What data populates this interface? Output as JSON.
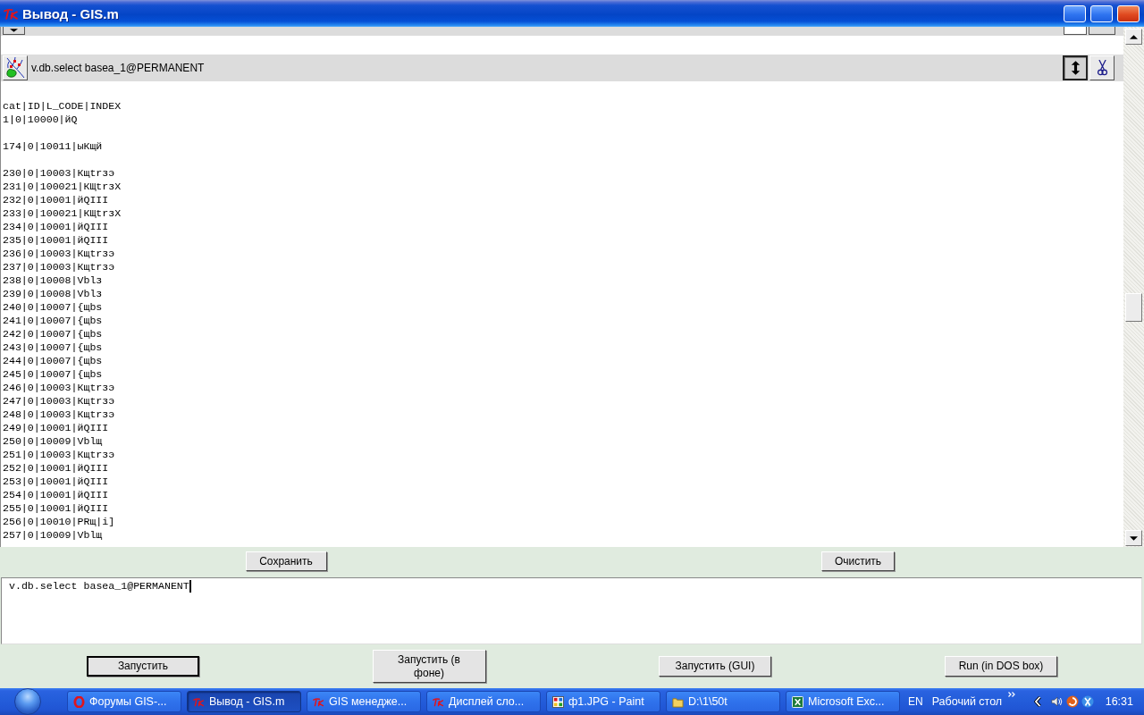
{
  "window": {
    "title": "Вывод - GIS.m"
  },
  "output_panel": {
    "header": {
      "command": "v.db.select basea_1@PERMANENT",
      "buttons": [
        {
          "kind": "resize",
          "pressed": true
        },
        {
          "kind": "cut",
          "pressed": false
        }
      ]
    },
    "output_blocks": [
      [
        "cat|ID|L_CODE|INDEX",
        "1|0|10000|йQ"
      ],
      [
        "174|0|10011|ыКщй"
      ],
      [
        "230|0|10003|Кщtrзэ",
        "231|0|100021|КЩtrзХ",
        "232|0|10001|йQIII",
        "233|0|100021|КЩtrзХ",
        "234|0|10001|йQIII",
        "235|0|10001|йQIII",
        "236|0|10003|Кщtrзэ",
        "237|0|10003|Кщtrзэ",
        "238|0|10008|Vblз",
        "239|0|10008|Vblз",
        "240|0|10007|{щbs",
        "241|0|10007|{щbs",
        "242|0|10007|{щbs",
        "243|0|10007|{щbs",
        "244|0|10007|{щbs",
        "245|0|10007|{щbs",
        "246|0|10003|Кщtrзэ",
        "247|0|10003|Кщtrзэ",
        "248|0|10003|Кщtrзэ",
        "249|0|10001|йQIII",
        "250|0|10009|Vblщ",
        "251|0|10003|Кщtrзэ",
        "252|0|10001|йQIII",
        "253|0|10001|йQIII",
        "254|0|10001|йQIII",
        "255|0|10001|йQIII",
        "256|0|10010|PRщ|i]",
        "257|0|10009|Vblщ"
      ]
    ]
  },
  "output_buttons": [
    {
      "label": "Сохранить"
    },
    {
      "label": "Очистить"
    }
  ],
  "command_field": {
    "value": "v.db.select basea_1@PERMANENT"
  },
  "run_buttons": [
    {
      "label": "Запустить",
      "default": true
    },
    {
      "label": "Запустить (в фоне)",
      "default": false
    },
    {
      "label": "Запустить (GUI)",
      "default": false
    },
    {
      "label": "Run (in DOS box)",
      "default": false
    }
  ],
  "taskbar": {
    "tasks": [
      {
        "label": "Форумы GIS-...",
        "kind": "browser",
        "selected": false
      },
      {
        "label": "Вывод - GIS.m",
        "kind": "tk",
        "selected": true
      },
      {
        "label": "GIS менедже...",
        "kind": "tk",
        "selected": false
      },
      {
        "label": "Дисплей сло...",
        "kind": "tk",
        "selected": false
      },
      {
        "label": "ф1.JPG - Paint",
        "kind": "paint",
        "selected": false
      },
      {
        "label": "D:\\1\\50t",
        "kind": "folder",
        "selected": false
      },
      {
        "label": "Microsoft Exc...",
        "kind": "spreadsheet",
        "selected": false
      }
    ],
    "language": "EN",
    "toolbar_label": "Рабочий стол",
    "clock": "16:31"
  }
}
